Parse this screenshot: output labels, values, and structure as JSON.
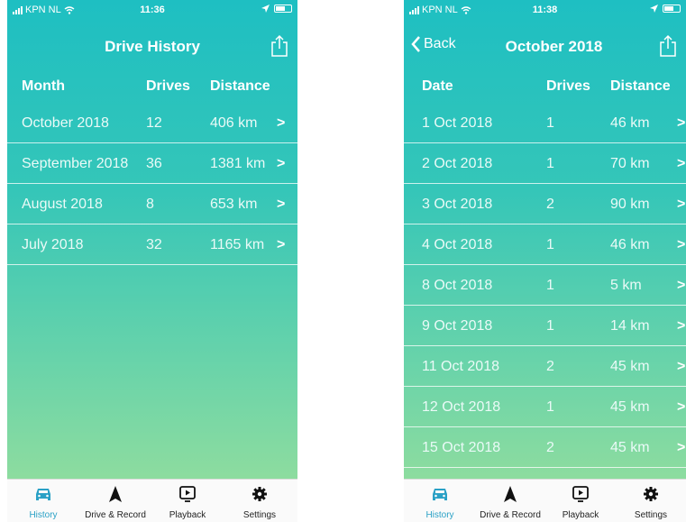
{
  "colors": {
    "accent": "#2aa1c6",
    "gradient_top": "#1ebfc2",
    "gradient_bottom": "#8ddc9f"
  },
  "left": {
    "status": {
      "carrier": "KPN NL",
      "time": "11:36"
    },
    "nav": {
      "title": "Drive History",
      "share_icon": "share-icon"
    },
    "columns": {
      "c1": "Month",
      "c2": "Drives",
      "c3": "Distance"
    },
    "rows": [
      {
        "c1": "October 2018",
        "c2": "12",
        "c3": "406 km"
      },
      {
        "c1": "September 2018",
        "c2": "36",
        "c3": "1381 km"
      },
      {
        "c1": "August 2018",
        "c2": "8",
        "c3": "653 km"
      },
      {
        "c1": "July 2018",
        "c2": "32",
        "c3": "1165 km"
      }
    ]
  },
  "right": {
    "status": {
      "carrier": "KPN NL",
      "time": "11:38"
    },
    "nav": {
      "back": "Back",
      "title": "October 2018",
      "share_icon": "share-icon"
    },
    "columns": {
      "c1": "Date",
      "c2": "Drives",
      "c3": "Distance"
    },
    "rows": [
      {
        "c1": "1 Oct 2018",
        "c2": "1",
        "c3": "46 km"
      },
      {
        "c1": "2 Oct 2018",
        "c2": "1",
        "c3": "70 km"
      },
      {
        "c1": "3 Oct 2018",
        "c2": "2",
        "c3": "90 km"
      },
      {
        "c1": "4 Oct 2018",
        "c2": "1",
        "c3": "46 km"
      },
      {
        "c1": "8 Oct 2018",
        "c2": "1",
        "c3": "5 km"
      },
      {
        "c1": "9 Oct 2018",
        "c2": "1",
        "c3": "14 km"
      },
      {
        "c1": "11 Oct 2018",
        "c2": "2",
        "c3": "45 km"
      },
      {
        "c1": "12 Oct 2018",
        "c2": "1",
        "c3": "45 km"
      },
      {
        "c1": "15 Oct 2018",
        "c2": "2",
        "c3": "45 km"
      }
    ]
  },
  "tabs": [
    {
      "label": "History",
      "icon": "car-icon",
      "active": true
    },
    {
      "label": "Drive & Record",
      "icon": "navigation-arrow-icon",
      "active": false
    },
    {
      "label": "Playback",
      "icon": "playback-icon",
      "active": false
    },
    {
      "label": "Settings",
      "icon": "gear-icon",
      "active": false
    }
  ]
}
